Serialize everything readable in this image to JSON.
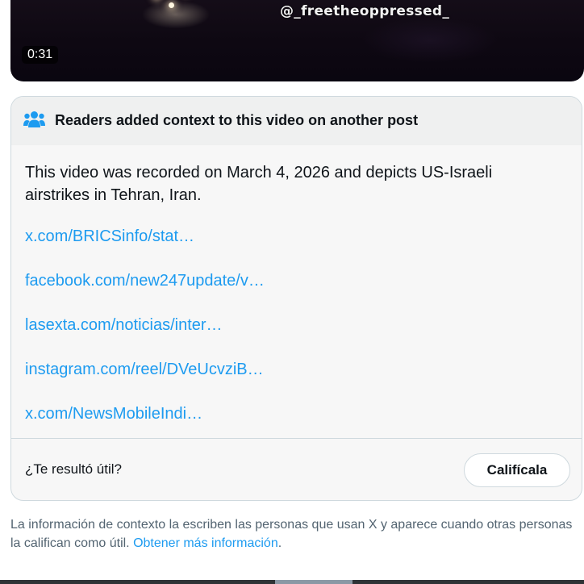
{
  "video": {
    "watermark": "@_freetheoppressed_",
    "duration": "0:31"
  },
  "context_card": {
    "header_icon": "people-icon",
    "header_title": "Readers added context to this video on another post",
    "note_text": "This video was recorded on March 4, 2026 and depicts US-Israeli airstrikes in Tehran, Iran.",
    "links": [
      "x.com/BRICSinfo/stat…",
      "facebook.com/new247update/v…",
      "lasexta.com/noticias/inter…",
      "instagram.com/reel/DVeUcvziB…",
      "x.com/NewsMobileIndi…"
    ],
    "helpful_question": "¿Te resultó útil?",
    "rate_button": "Califícala"
  },
  "footer": {
    "text": "La información de contexto la escriben las personas que usan X y aparece cuando otras personas la califican como útil.",
    "link": "Obtener más información",
    "trailing": "."
  },
  "colors": {
    "link": "#1d9bf0",
    "text": "#0f1419",
    "muted": "#536471",
    "icon": "#1d9bf0"
  }
}
